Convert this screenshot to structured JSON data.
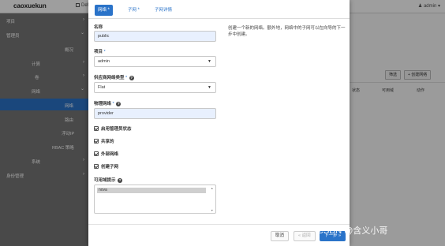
{
  "topbar": {
    "brand": "caoxuekun",
    "project": "Default",
    "user": "admin"
  },
  "sidebar": {
    "items": [
      {
        "label": "项目",
        "chevron": "›"
      },
      {
        "label": "管理员",
        "chevron": "⌄"
      },
      {
        "label": "概况"
      },
      {
        "label": "计算",
        "chevron": "›"
      },
      {
        "label": "卷",
        "chevron": "›"
      },
      {
        "label": "网络",
        "chevron": "⌄"
      },
      {
        "label": "网络"
      },
      {
        "label": "路由"
      },
      {
        "label": "浮动IP"
      },
      {
        "label": "RBAC 策略"
      },
      {
        "label": "系统",
        "chevron": "›"
      },
      {
        "label": "身份管理",
        "chevron": "›"
      }
    ]
  },
  "main": {
    "title": "网",
    "filter_btn": "筛选",
    "create_btn": "+ 创建网络",
    "columns": [
      "状态",
      "管理员状态",
      "可用域",
      "动作"
    ]
  },
  "modal": {
    "tabs": [
      {
        "label": "网络",
        "req": "*"
      },
      {
        "label": "子网",
        "req": "*"
      },
      {
        "label": "子网详情",
        "req": ""
      }
    ],
    "name_label": "名称",
    "name_value": "public",
    "project_label": "项目",
    "project_req": "*",
    "project_value": "admin",
    "provider_type_label": "供应商网络类型",
    "provider_type_req": "*",
    "provider_type_value": "Flat",
    "physnet_label": "物理网络",
    "physnet_req": "*",
    "physnet_value": "provider",
    "checkboxes": [
      {
        "label": "启用管理员状态"
      },
      {
        "label": "共享的"
      },
      {
        "label": "外部网络"
      },
      {
        "label": "创建子网"
      }
    ],
    "az_hints_label": "可用域提示",
    "az_hints_options": [
      "nova"
    ],
    "description": "创建一个新的网络。额外地，网络中的子网可以在向导的下一步中创建。",
    "footer": {
      "cancel": "取消",
      "back": "« 返回",
      "next": "下一步 »"
    }
  },
  "icons": {
    "help": "?",
    "select_caret": "▼",
    "scroll_up": "▲",
    "scroll_down": "▼",
    "checkmark": "✔"
  },
  "watermark": "CSDN @含义小哥",
  "colors": {
    "accent": "#2a73c9",
    "sidebar": "#767676",
    "active_row": "#2a73c9"
  }
}
